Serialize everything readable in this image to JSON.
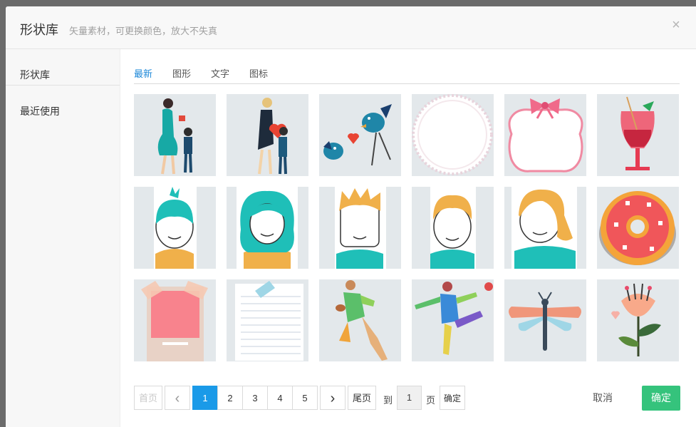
{
  "header": {
    "title": "形状库",
    "subtitle": "矢量素材，可更换颜色，放大不失真",
    "close_icon": "×"
  },
  "sidebar": {
    "items": [
      {
        "label": "形状库"
      },
      {
        "label": "最近使用"
      }
    ]
  },
  "tabs": [
    {
      "label": "最新",
      "active": true
    },
    {
      "label": "图形",
      "active": false
    },
    {
      "label": "文字",
      "active": false
    },
    {
      "label": "图标",
      "active": false
    }
  ],
  "grid": {
    "items": [
      {
        "icon": "mother-and-child-illustration"
      },
      {
        "icon": "father-and-child-illustration"
      },
      {
        "icon": "love-birds-illustration"
      },
      {
        "icon": "lace-doily-frame"
      },
      {
        "icon": "ribbon-bow-frame"
      },
      {
        "icon": "cocktail-drink-illustration"
      },
      {
        "icon": "boy-teal-hair-avatar"
      },
      {
        "icon": "girl-teal-curly-hair-avatar"
      },
      {
        "icon": "boy-spiky-hair-avatar"
      },
      {
        "icon": "boy-orange-hair-avatar"
      },
      {
        "icon": "girl-blonde-hair-avatar"
      },
      {
        "icon": "donut-illustration"
      },
      {
        "icon": "polka-dot-note-paper"
      },
      {
        "icon": "lined-notebook-paper"
      },
      {
        "icon": "rugby-player-illustration"
      },
      {
        "icon": "soccer-player-illustration"
      },
      {
        "icon": "dragonfly-illustration"
      },
      {
        "icon": "flower-illustration"
      }
    ]
  },
  "pagination": {
    "first_label": "首页",
    "prev_icon": "‹",
    "pages": [
      "1",
      "2",
      "3",
      "4",
      "5"
    ],
    "current_page": "1",
    "next_icon": "›",
    "last_label": "尾页",
    "goto_label": "到",
    "goto_value": "1",
    "page_suffix": "页",
    "confirm_label": "确定"
  },
  "footer": {
    "cancel_label": "取消",
    "ok_label": "确定"
  },
  "colors": {
    "accent": "#1a9ae8",
    "ok_button": "#35c37c",
    "tile_bg": "#e3e8eb",
    "teal": "#1fbfb8"
  }
}
